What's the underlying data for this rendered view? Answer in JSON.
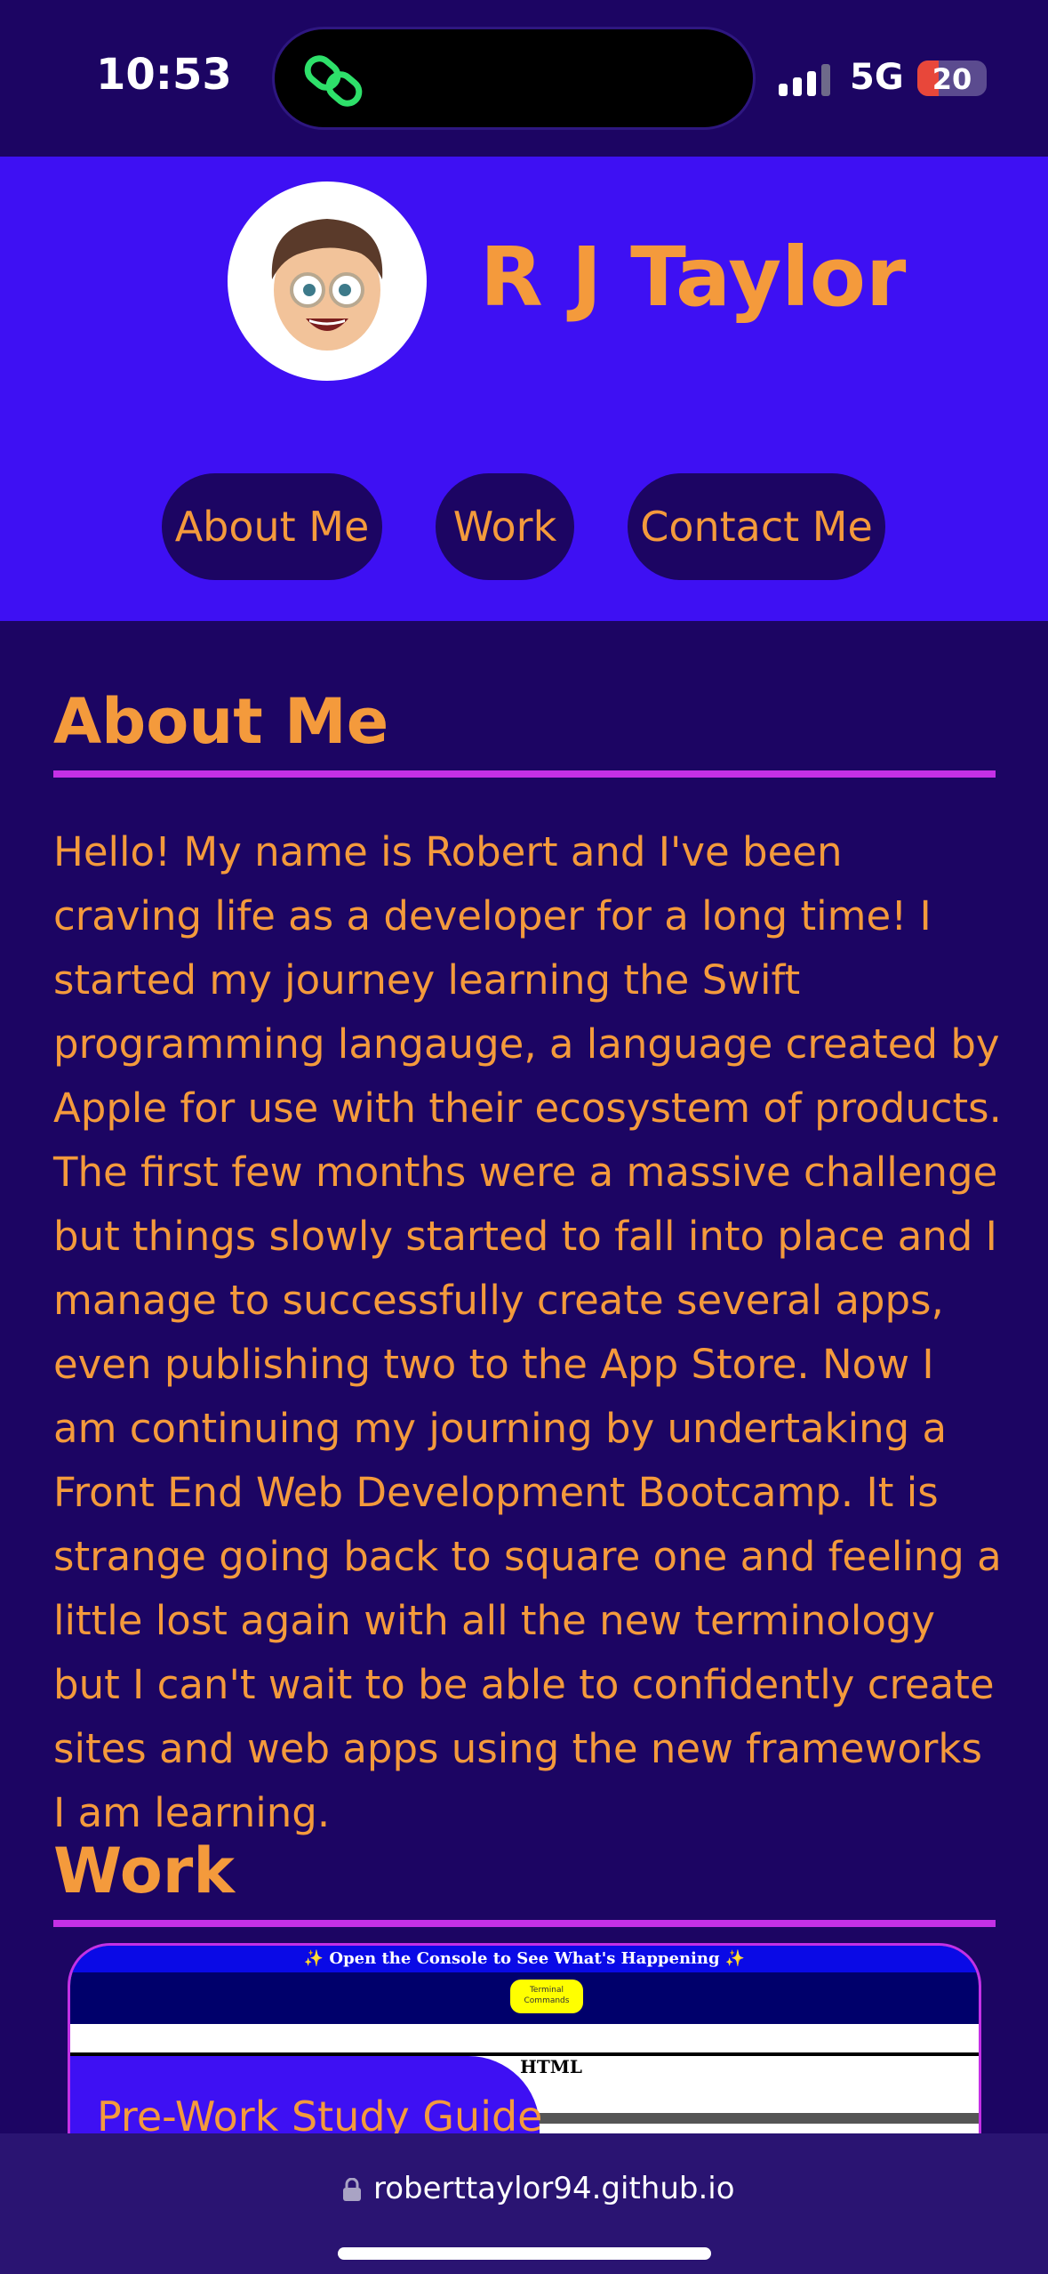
{
  "status_bar": {
    "time": "10:53",
    "network": "5G",
    "battery": "20"
  },
  "header": {
    "site_title": "R J Taylor",
    "avatar_icon": "memoji-avatar",
    "nav": [
      "About Me",
      "Work",
      "Contact Me"
    ]
  },
  "about": {
    "heading": "About Me",
    "text": "Hello! My name is Robert and I've been craving life as a developer for a long time! I started my journey learning the Swift programming langauge, a language created by Apple for use with their ecosystem of products. The first few months were a massive challenge but things slowly started to fall into place and I manage to successfully create several apps, even publishing two to the App Store. Now I am continuing my journing by undertaking a Front End Web Development Bootcamp. It is strange going back to square one and feeling a little lost again with all the new terminology but I can't wait to be able to confidently create sites and web apps using the new frameworks I am learning."
  },
  "work": {
    "heading": "Work",
    "card": {
      "preview_title": "✨ Open the Console to See What's Happening ✨",
      "preview_button": "Terminal Commands",
      "preview_label": "HTML",
      "caption": "Pre-Work Study Guide"
    }
  },
  "browser": {
    "url": "roberttaylor94.github.io"
  },
  "colors": {
    "background": "#1c0563",
    "header": "#3e10f3",
    "accent_text": "#f49a3c",
    "rule": "#c430e6"
  }
}
